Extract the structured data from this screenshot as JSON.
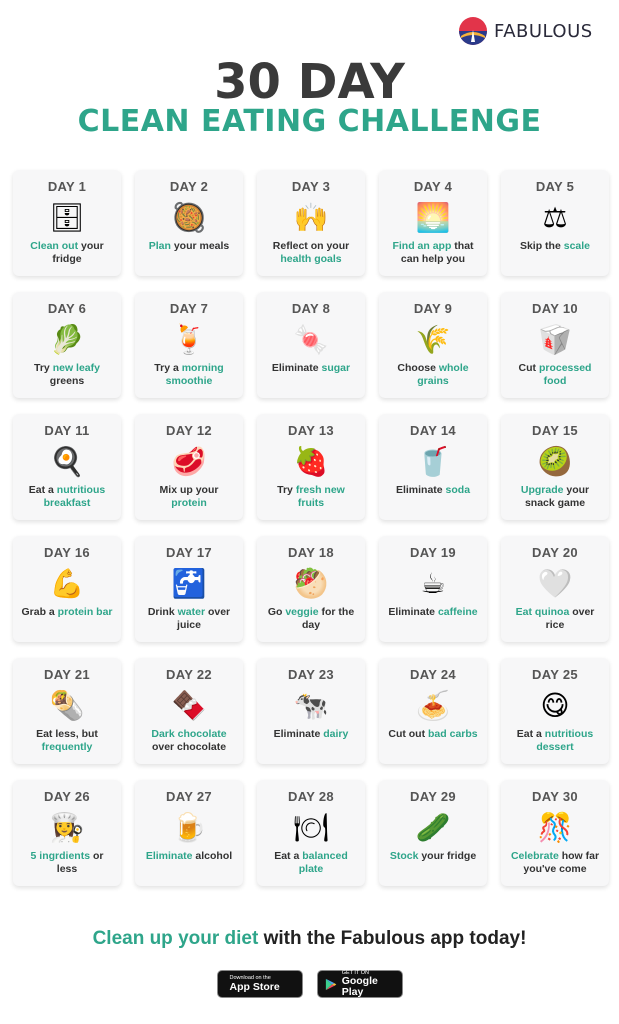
{
  "brand": {
    "name": "FABULOUS"
  },
  "title": {
    "main": "30 DAY",
    "sub": "CLEAN EATING CHALLENGE"
  },
  "days": [
    {
      "label": "DAY 1",
      "icon": "🗄",
      "icon_name": "fridge-icon",
      "parts": [
        {
          "t": "Clean out",
          "h": true
        },
        {
          "t": " your fridge",
          "h": false
        }
      ]
    },
    {
      "label": "DAY 2",
      "icon": "🥘",
      "icon_name": "paella-icon",
      "parts": [
        {
          "t": "Plan",
          "h": true
        },
        {
          "t": " your meals",
          "h": false
        }
      ]
    },
    {
      "label": "DAY 3",
      "icon": "🙌",
      "icon_name": "raising-hands-icon",
      "parts": [
        {
          "t": "Reflect on your ",
          "h": false
        },
        {
          "t": "health goals",
          "h": true
        }
      ]
    },
    {
      "label": "DAY 4",
      "icon": "🌅",
      "icon_name": "fabulous-logo-icon",
      "parts": [
        {
          "t": "Find an app",
          "h": true
        },
        {
          "t": " that can help you",
          "h": false
        }
      ]
    },
    {
      "label": "DAY 5",
      "icon": "⚖",
      "icon_name": "scale-icon",
      "parts": [
        {
          "t": "Skip the ",
          "h": false
        },
        {
          "t": "scale",
          "h": true
        }
      ]
    },
    {
      "label": "DAY 6",
      "icon": "🥬",
      "icon_name": "leafy-green-icon",
      "parts": [
        {
          "t": "Try ",
          "h": false
        },
        {
          "t": "new leafy",
          "h": true
        },
        {
          "t": " greens",
          "h": false
        }
      ]
    },
    {
      "label": "DAY 7",
      "icon": "🍹",
      "icon_name": "smoothie-icon",
      "parts": [
        {
          "t": "Try a ",
          "h": false
        },
        {
          "t": "morning smoothie",
          "h": true
        }
      ]
    },
    {
      "label": "DAY 8",
      "icon": "🍬",
      "icon_name": "candy-icon",
      "parts": [
        {
          "t": "Eliminate ",
          "h": false
        },
        {
          "t": "sugar",
          "h": true
        }
      ]
    },
    {
      "label": "DAY 9",
      "icon": "🌾",
      "icon_name": "grain-icon",
      "parts": [
        {
          "t": "Choose ",
          "h": false
        },
        {
          "t": "whole grains",
          "h": true
        }
      ]
    },
    {
      "label": "DAY 10",
      "icon": "🥡",
      "icon_name": "takeout-box-icon",
      "parts": [
        {
          "t": "Cut ",
          "h": false
        },
        {
          "t": "processed food",
          "h": true
        }
      ]
    },
    {
      "label": "DAY 11",
      "icon": "🍳",
      "icon_name": "frying-pan-egg-icon",
      "parts": [
        {
          "t": "Eat a ",
          "h": false
        },
        {
          "t": "nutritious breakfast",
          "h": true
        }
      ]
    },
    {
      "label": "DAY 12",
      "icon": "🥩",
      "icon_name": "steak-icon",
      "parts": [
        {
          "t": "Mix up your ",
          "h": false
        },
        {
          "t": "protein",
          "h": true
        }
      ]
    },
    {
      "label": "DAY 13",
      "icon": "🍓",
      "icon_name": "strawberry-icon",
      "parts": [
        {
          "t": "Try ",
          "h": false
        },
        {
          "t": "fresh new fruits",
          "h": true
        }
      ]
    },
    {
      "label": "DAY 14",
      "icon": "🥤",
      "icon_name": "soda-cup-icon",
      "parts": [
        {
          "t": "Eliminate ",
          "h": false
        },
        {
          "t": "soda",
          "h": true
        }
      ]
    },
    {
      "label": "DAY 15",
      "icon": "🥝",
      "icon_name": "kiwi-icon",
      "parts": [
        {
          "t": "Upgrade",
          "h": true
        },
        {
          "t": " your snack game",
          "h": false
        }
      ]
    },
    {
      "label": "DAY 16",
      "icon": "💪",
      "icon_name": "flexed-bicep-icon",
      "parts": [
        {
          "t": "Grab a ",
          "h": false
        },
        {
          "t": "protein bar",
          "h": true
        }
      ]
    },
    {
      "label": "DAY 17",
      "icon": "🚰",
      "icon_name": "water-tap-icon",
      "parts": [
        {
          "t": "Drink ",
          "h": false
        },
        {
          "t": "water",
          "h": true
        },
        {
          "t": " over juice",
          "h": false
        }
      ]
    },
    {
      "label": "DAY 18",
      "icon": "🥙",
      "icon_name": "veggie-wrap-icon",
      "parts": [
        {
          "t": "Go ",
          "h": false
        },
        {
          "t": "veggie",
          "h": true
        },
        {
          "t": " for the day",
          "h": false
        }
      ]
    },
    {
      "label": "DAY 19",
      "icon": "☕",
      "icon_name": "coffee-cup-icon",
      "parts": [
        {
          "t": "Eliminate ",
          "h": false
        },
        {
          "t": "caffeine",
          "h": true
        }
      ]
    },
    {
      "label": "DAY 20",
      "icon": "🤍",
      "icon_name": "quinoa-heart-icon",
      "parts": [
        {
          "t": "Eat quinoa",
          "h": true
        },
        {
          "t": " over rice",
          "h": false
        }
      ]
    },
    {
      "label": "DAY 21",
      "icon": "🌯",
      "icon_name": "burrito-icon",
      "parts": [
        {
          "t": "Eat less, but ",
          "h": false
        },
        {
          "t": "frequently",
          "h": true
        }
      ]
    },
    {
      "label": "DAY 22",
      "icon": "🍫",
      "icon_name": "chocolate-bar-icon",
      "parts": [
        {
          "t": "Dark chocolate",
          "h": true
        },
        {
          "t": " over chocolate",
          "h": false
        }
      ]
    },
    {
      "label": "DAY 23",
      "icon": "🐄",
      "icon_name": "cow-icon",
      "parts": [
        {
          "t": "Eliminate ",
          "h": false
        },
        {
          "t": "dairy",
          "h": true
        }
      ]
    },
    {
      "label": "DAY 24",
      "icon": "🍝",
      "icon_name": "spaghetti-icon",
      "parts": [
        {
          "t": "Cut out ",
          "h": false
        },
        {
          "t": "bad carbs",
          "h": true
        }
      ]
    },
    {
      "label": "DAY 25",
      "icon": "😋",
      "icon_name": "yum-face-icon",
      "parts": [
        {
          "t": "Eat a ",
          "h": false
        },
        {
          "t": "nutritious dessert",
          "h": true
        }
      ]
    },
    {
      "label": "DAY 26",
      "icon": "👩‍🍳",
      "icon_name": "chef-icon",
      "parts": [
        {
          "t": "5 ingrdients",
          "h": true
        },
        {
          "t": " or less",
          "h": false
        }
      ]
    },
    {
      "label": "DAY 27",
      "icon": "🍺",
      "icon_name": "beer-mug-icon",
      "parts": [
        {
          "t": "Eliminate",
          "h": true
        },
        {
          "t": " alcohol",
          "h": false
        }
      ]
    },
    {
      "label": "DAY 28",
      "icon": "🍽",
      "icon_name": "plate-cutlery-icon",
      "parts": [
        {
          "t": "Eat a ",
          "h": false
        },
        {
          "t": "balanced plate",
          "h": true
        }
      ]
    },
    {
      "label": "DAY 29",
      "icon": "🥒",
      "icon_name": "cucumber-icon",
      "parts": [
        {
          "t": "Stock",
          "h": true
        },
        {
          "t": " your fridge",
          "h": false
        }
      ]
    },
    {
      "label": "DAY 30",
      "icon": "🎊",
      "icon_name": "confetti-icon",
      "parts": [
        {
          "t": "Celebrate",
          "h": true
        },
        {
          "t": " how far you've come",
          "h": false
        }
      ]
    }
  ],
  "footer": {
    "highlight": "Clean up your diet",
    "rest": " with the Fabulous app today!"
  },
  "badges": {
    "appstore": {
      "small": "Download on the",
      "big": "App Store",
      "icon_name": "apple-icon"
    },
    "googleplay": {
      "small": "GET IT ON",
      "big": "Google Play",
      "icon_name": "google-play-icon"
    }
  },
  "colors": {
    "accent": "#2ea58a",
    "title": "#3a3a3a",
    "card_bg": "#f7f7f8"
  }
}
